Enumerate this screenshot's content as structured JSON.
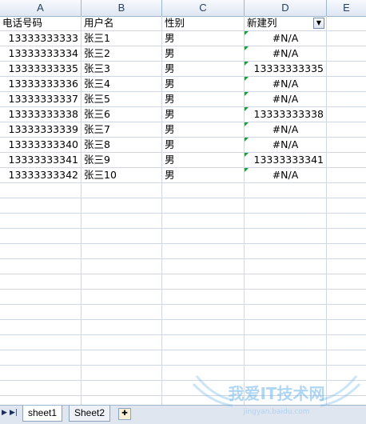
{
  "columns": [
    "A",
    "B",
    "C",
    "D",
    "E"
  ],
  "headers": {
    "a": "电话号码",
    "b": "用户名",
    "c": "性别",
    "d": "新建列"
  },
  "filter_glyph": "▼",
  "rows": [
    {
      "a": "13333333333",
      "b": "张三1",
      "c": "男",
      "d": "#N/A"
    },
    {
      "a": "13333333334",
      "b": "张三2",
      "c": "男",
      "d": "#N/A"
    },
    {
      "a": "13333333335",
      "b": "张三3",
      "c": "男",
      "d": "13333333335"
    },
    {
      "a": "13333333336",
      "b": "张三4",
      "c": "男",
      "d": "#N/A"
    },
    {
      "a": "13333333337",
      "b": "张三5",
      "c": "男",
      "d": "#N/A"
    },
    {
      "a": "13333333338",
      "b": "张三6",
      "c": "男",
      "d": "13333333338"
    },
    {
      "a": "13333333339",
      "b": "张三7",
      "c": "男",
      "d": "#N/A"
    },
    {
      "a": "13333333340",
      "b": "张三8",
      "c": "男",
      "d": "#N/A"
    },
    {
      "a": "13333333341",
      "b": "张三9",
      "c": "男",
      "d": "13333333341"
    },
    {
      "a": "13333333342",
      "b": "张三10",
      "c": "男",
      "d": "#N/A"
    }
  ],
  "tabs": {
    "nav_next": "▶",
    "nav_last": "▶|",
    "sheet1": "sheet1",
    "sheet2": "Sheet2",
    "new_sheet_glyph": "✚"
  },
  "watermark": {
    "text": "我爱IT技术网",
    "url": "jingyan.baidu.com"
  },
  "colors": {
    "grid": "#d0d7e5",
    "header_border": "#9eb6ce",
    "error_indicator": "#1e9a3c"
  }
}
